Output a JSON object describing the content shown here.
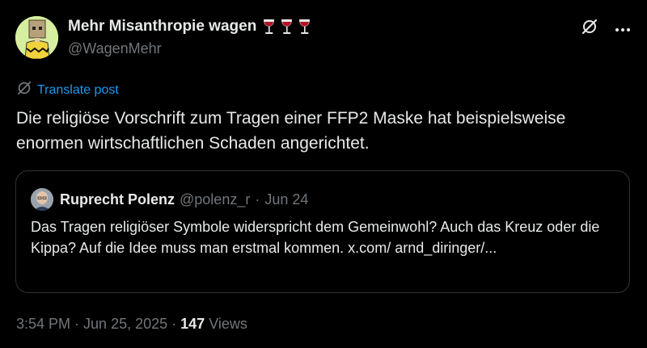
{
  "author": {
    "name": "Mehr Misanthropie wagen",
    "handle": "@WagenMehr",
    "emoji_count": 3
  },
  "translate_label": "Translate post",
  "post_text": "Die religiöse Vorschrift zum Tragen einer FFP2 Maske hat beispielsweise enormen wirtschaftlichen Schaden angerichtet.",
  "quote": {
    "name": "Ruprecht Polenz",
    "handle": "@polenz_r",
    "separator": "·",
    "date": "Jun 24",
    "text": "Das Tragen religiöser Symbole widerspricht dem Gemeinwohl? Auch das Kreuz oder die Kippa? Auf die Idee muss man erstmal kommen. x.com/ arnd_diringer/..."
  },
  "footer": {
    "time": "3:54 PM",
    "sep1": "·",
    "date": "Jun 25, 2025",
    "sep2": "·",
    "views_count": "147",
    "views_label": "Views"
  },
  "icons": {
    "grok": "grok-icon",
    "more": "more-options-icon",
    "translate": "translate-icon"
  },
  "colors": {
    "background": "#000000",
    "text": "#e7e9ea",
    "muted": "#71767b",
    "link": "#1d9bf0",
    "border": "#2f3336"
  }
}
